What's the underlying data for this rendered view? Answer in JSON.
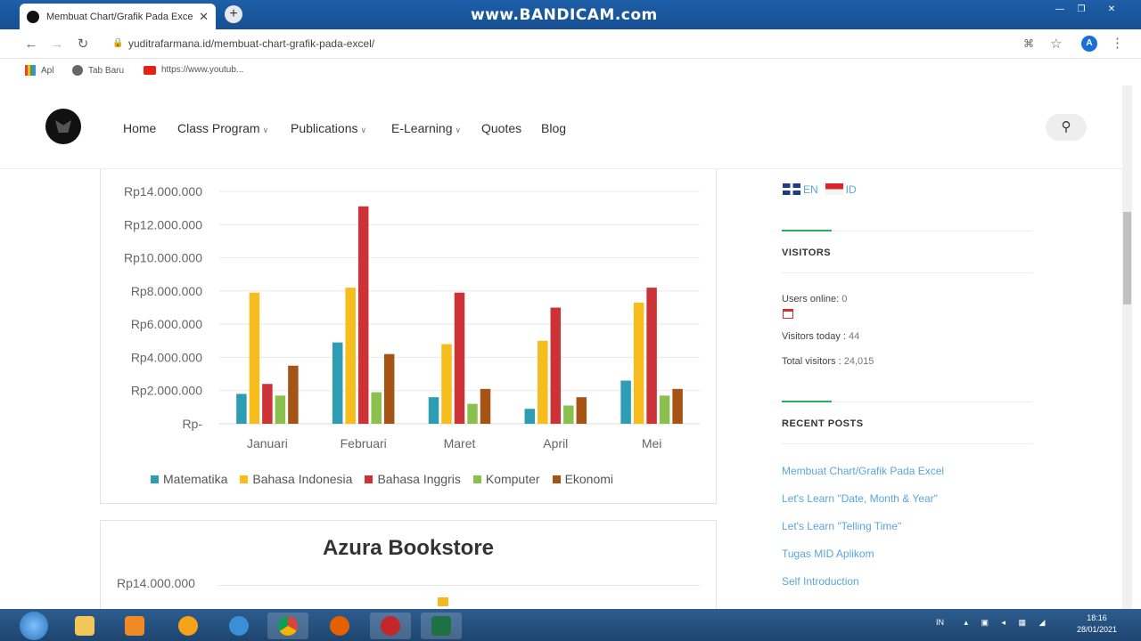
{
  "browser": {
    "tab_title": "Membuat Chart/Grafik Pada Exce",
    "new_tab": "+",
    "watermark": "www.BANDICAM.com",
    "url": "yuditrafarmana.id/membuat-chart-grafik-pada-excel/",
    "avatar_letter": "A",
    "bookmarks": [
      "Apl",
      "Tab Baru",
      "https://www.youtub..."
    ]
  },
  "site": {
    "nav": [
      {
        "label": "Home",
        "dropdown": false
      },
      {
        "label": "Class Program",
        "dropdown": true
      },
      {
        "label": "Publications",
        "dropdown": true
      },
      {
        "label": "E-Learning",
        "dropdown": true
      },
      {
        "label": "Quotes",
        "dropdown": false
      },
      {
        "label": "Blog",
        "dropdown": false
      }
    ]
  },
  "chart_data": {
    "type": "bar",
    "title": "",
    "categories": [
      "Januari",
      "Februari",
      "Maret",
      "April",
      "Mei"
    ],
    "y_ticks": [
      "Rp14.000.000",
      "Rp12.000.000",
      "Rp10.000.000",
      "Rp8.000.000",
      "Rp6.000.000",
      "Rp4.000.000",
      "Rp2.000.000",
      "Rp-"
    ],
    "ylim": [
      0,
      14000000
    ],
    "grid": true,
    "legend_position": "bottom",
    "series": [
      {
        "name": "Matematika",
        "color": "#2e9db3",
        "values": [
          1800000,
          4900000,
          1600000,
          900000,
          2600000
        ]
      },
      {
        "name": "Bahasa Indonesia",
        "color": "#f6bd1d",
        "values": [
          7900000,
          8200000,
          4800000,
          5000000,
          7300000
        ]
      },
      {
        "name": "Bahasa Inggris",
        "color": "#cd3237",
        "values": [
          2400000,
          13100000,
          7900000,
          7000000,
          8200000
        ]
      },
      {
        "name": "Komputer",
        "color": "#8bc04f",
        "values": [
          1700000,
          1900000,
          1200000,
          1100000,
          1700000
        ]
      },
      {
        "name": "Ekonomi",
        "color": "#a55416",
        "values": [
          3500000,
          4200000,
          2100000,
          1600000,
          2100000
        ]
      }
    ]
  },
  "second_chart": {
    "title": "Azura Bookstore",
    "first_tick": "Rp14.000.000"
  },
  "sidebar": {
    "languages": [
      "EN",
      "ID"
    ],
    "visitors_heading": "VISITORS",
    "users_online_label": "Users online:",
    "users_online_value": "0",
    "visitors_today_label": "Visitors today :",
    "visitors_today_value": "44",
    "total_visitors_label": "Total visitors :",
    "total_visitors_value": "24,015",
    "recent_posts_heading": "RECENT POSTS",
    "recent_posts": [
      "Membuat Chart/Grafik Pada Excel",
      "Let's Learn \"Date, Month & Year\"",
      "Let's Learn \"Telling Time\"",
      "Tugas MID Aplikom",
      "Self Introduction"
    ]
  },
  "taskbar": {
    "lang": "IN",
    "time": "18:16",
    "date": "28/01/2021"
  }
}
